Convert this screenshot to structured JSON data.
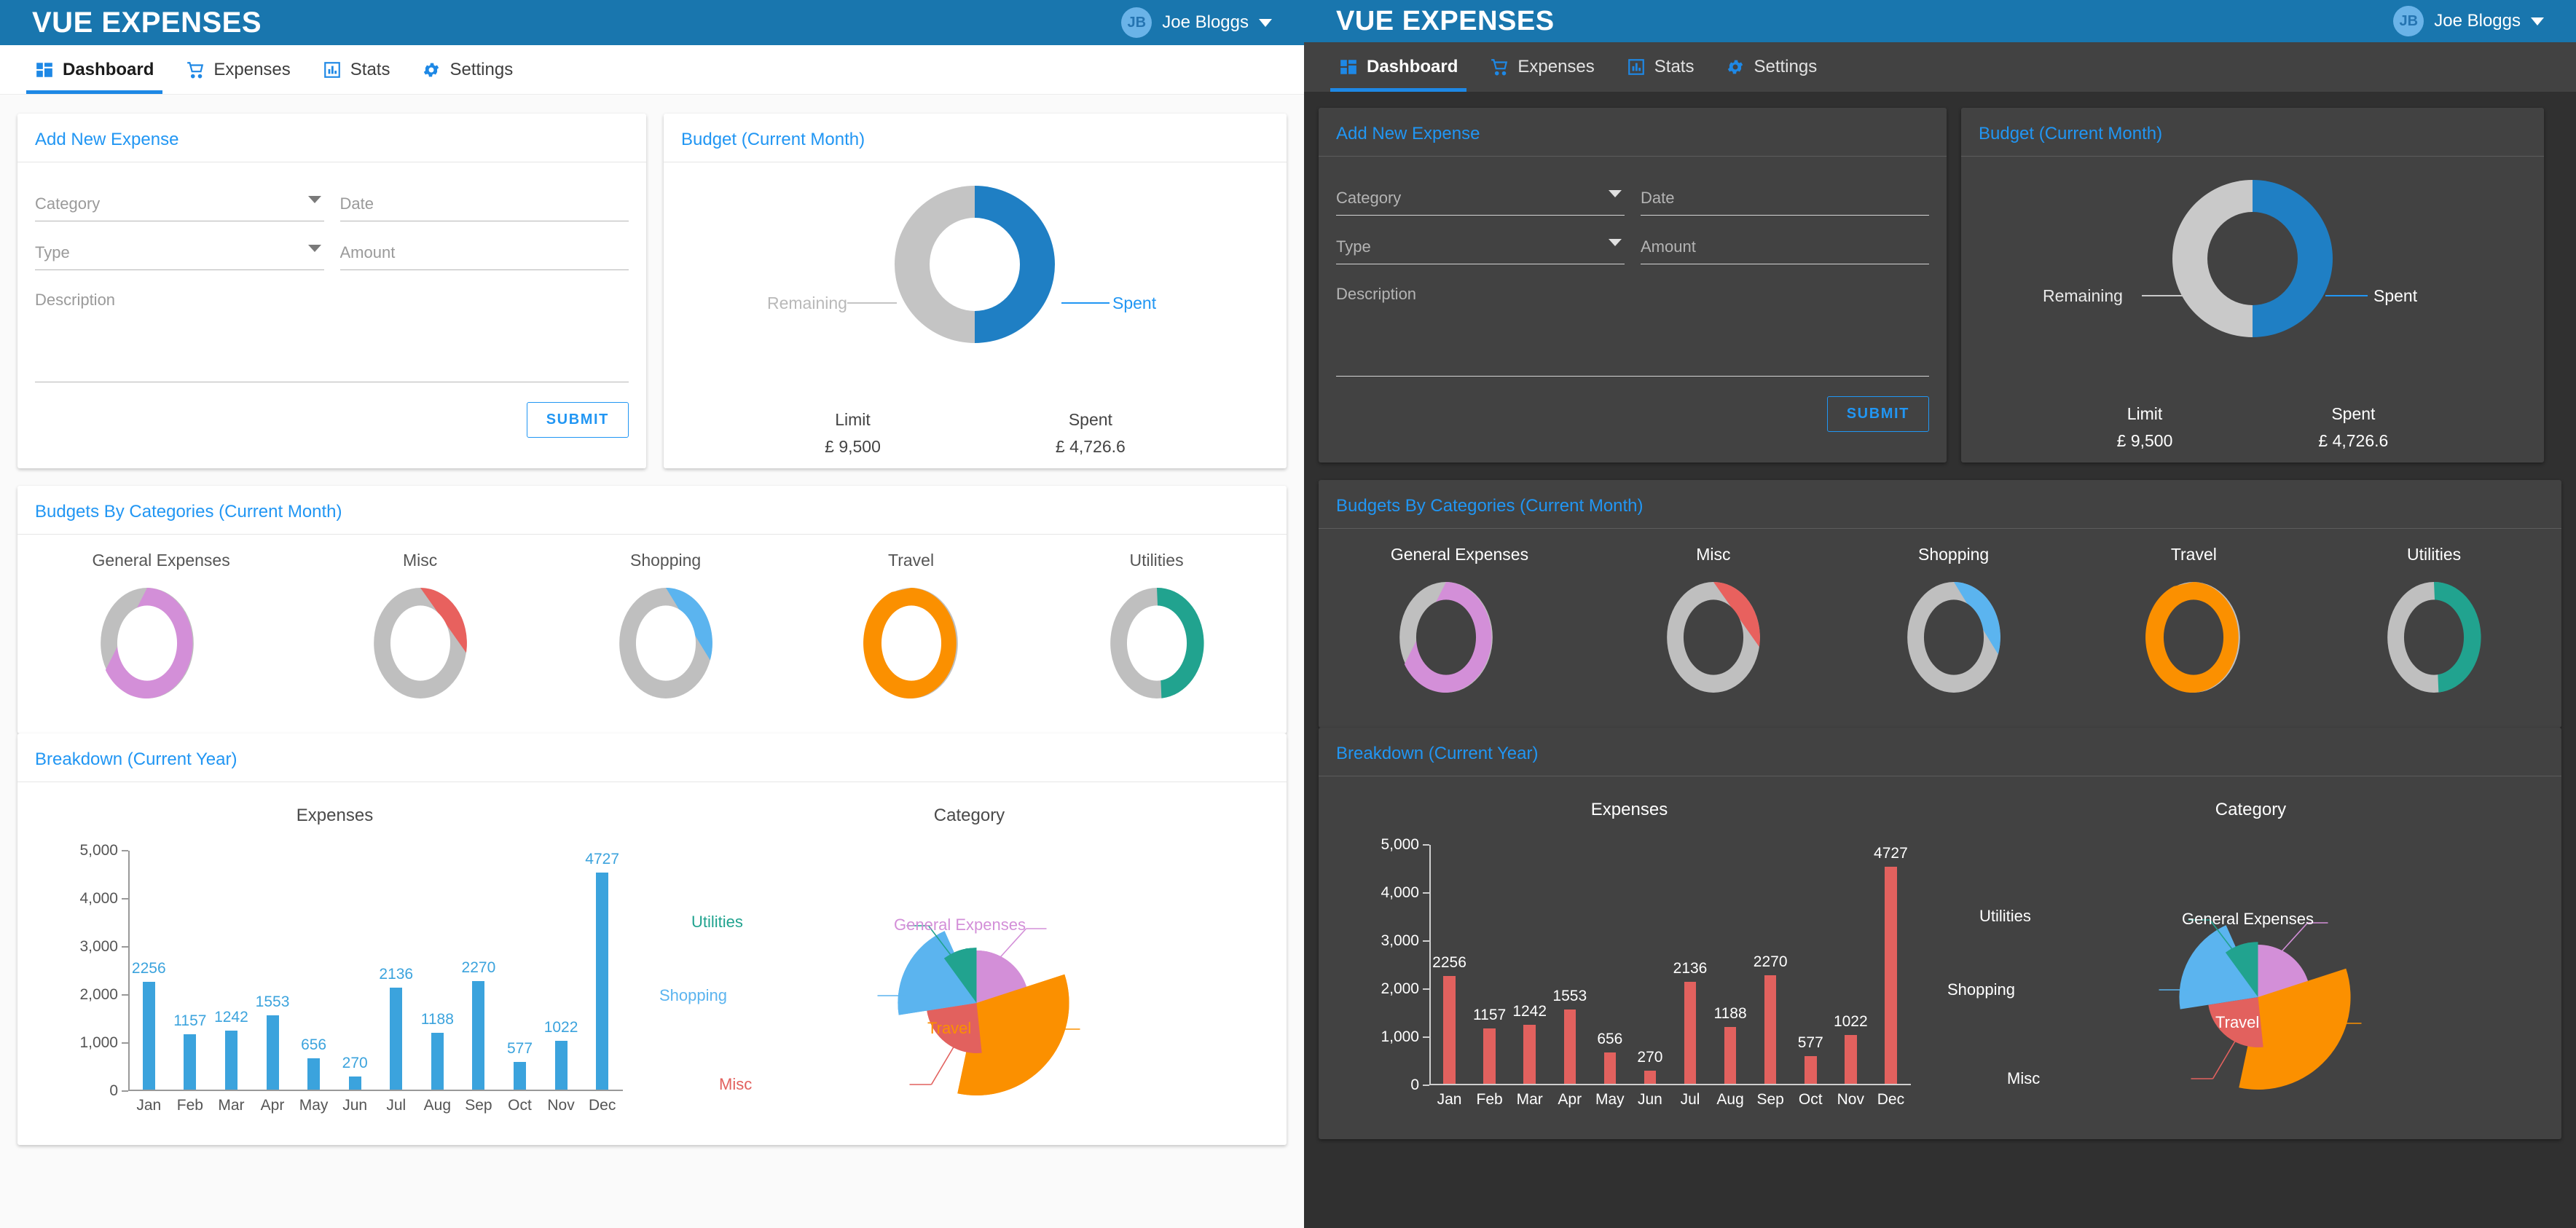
{
  "app": {
    "brand": "VUE EXPENSES",
    "user": {
      "initials": "JB",
      "name": "Joe Bloggs"
    },
    "accent": "#2196f3",
    "appbar_bg": "#1976ae"
  },
  "tabs": [
    {
      "label": "Dashboard",
      "icon": "dashboard-icon",
      "active": true
    },
    {
      "label": "Expenses",
      "icon": "cart-icon",
      "active": false
    },
    {
      "label": "Stats",
      "icon": "bar-chart-icon",
      "active": false
    },
    {
      "label": "Settings",
      "icon": "gear-icon",
      "active": false
    }
  ],
  "add_expense": {
    "title": "Add New Expense",
    "fields": {
      "category": {
        "placeholder": "Category",
        "value": ""
      },
      "date": {
        "placeholder": "Date",
        "value": ""
      },
      "type": {
        "placeholder": "Type",
        "value": ""
      },
      "amount": {
        "placeholder": "Amount",
        "value": ""
      },
      "description": {
        "placeholder": "Description",
        "value": ""
      }
    },
    "submit_label": "SUBMIT"
  },
  "budget": {
    "title": "Budget (Current Month)",
    "label_remaining": "Remaining",
    "label_spent": "Spent",
    "limit_key": "Limit",
    "limit_value": "£ 9,500",
    "spent_key": "Spent",
    "spent_value": "£ 4,726.6"
  },
  "categories_card": {
    "title": "Budgets By Categories (Current Month)"
  },
  "breakdown": {
    "title": "Breakdown (Current Year)"
  },
  "chart_data": [
    {
      "type": "pie",
      "name": "budget-donut",
      "title": "Budget (Current Month)",
      "labels": [
        "Spent",
        "Remaining"
      ],
      "values": [
        4726.6,
        4773.4
      ],
      "colors": [
        "#1f7fc4",
        "#c4c4c4"
      ],
      "limit": 9500,
      "currency": "£",
      "legend": "outside-callout"
    },
    {
      "type": "pie",
      "name": "category-budget-donuts",
      "title": "Budgets By Categories (Current Month)",
      "categories": [
        "General Expenses",
        "Misc",
        "Shopping",
        "Travel",
        "Utilities"
      ],
      "spent_percent": [
        60,
        25,
        28,
        93,
        48
      ],
      "colors": [
        "#d38fd8",
        "#e8615e",
        "#5bb4ef",
        "#fb9000",
        "#21a38f"
      ],
      "track_color": "#bfbfbf"
    },
    {
      "type": "bar",
      "name": "expenses-by-month",
      "title": "Expenses",
      "categories": [
        "Jan",
        "Feb",
        "Mar",
        "Apr",
        "May",
        "Jun",
        "Jul",
        "Aug",
        "Sep",
        "Oct",
        "Nov",
        "Dec"
      ],
      "values": [
        2256,
        1157,
        1242,
        1553,
        656,
        270,
        2136,
        1188,
        2270,
        577,
        1022,
        4727
      ],
      "ylim": [
        0,
        5000
      ],
      "yticks": [
        "0",
        "1,000",
        "2,000",
        "3,000",
        "4,000",
        "5,000"
      ],
      "xlabel": "",
      "ylabel": "",
      "grid": false,
      "bar_color_light": "#3ba3dd",
      "bar_color_dark": "#e2615e"
    },
    {
      "type": "pie",
      "name": "category-breakdown",
      "title": "Category",
      "variant": "polar-area",
      "labels": [
        "General Expenses",
        "Travel",
        "Misc",
        "Shopping",
        "Utilities"
      ],
      "values": [
        15,
        28,
        12,
        24,
        16
      ],
      "radii_percent": [
        58,
        100,
        55,
        86,
        62
      ],
      "colors": [
        "#d38fd8",
        "#fb9000",
        "#e2615e",
        "#5bb4ef",
        "#21a38f"
      ],
      "legend": "callout-labels"
    }
  ]
}
